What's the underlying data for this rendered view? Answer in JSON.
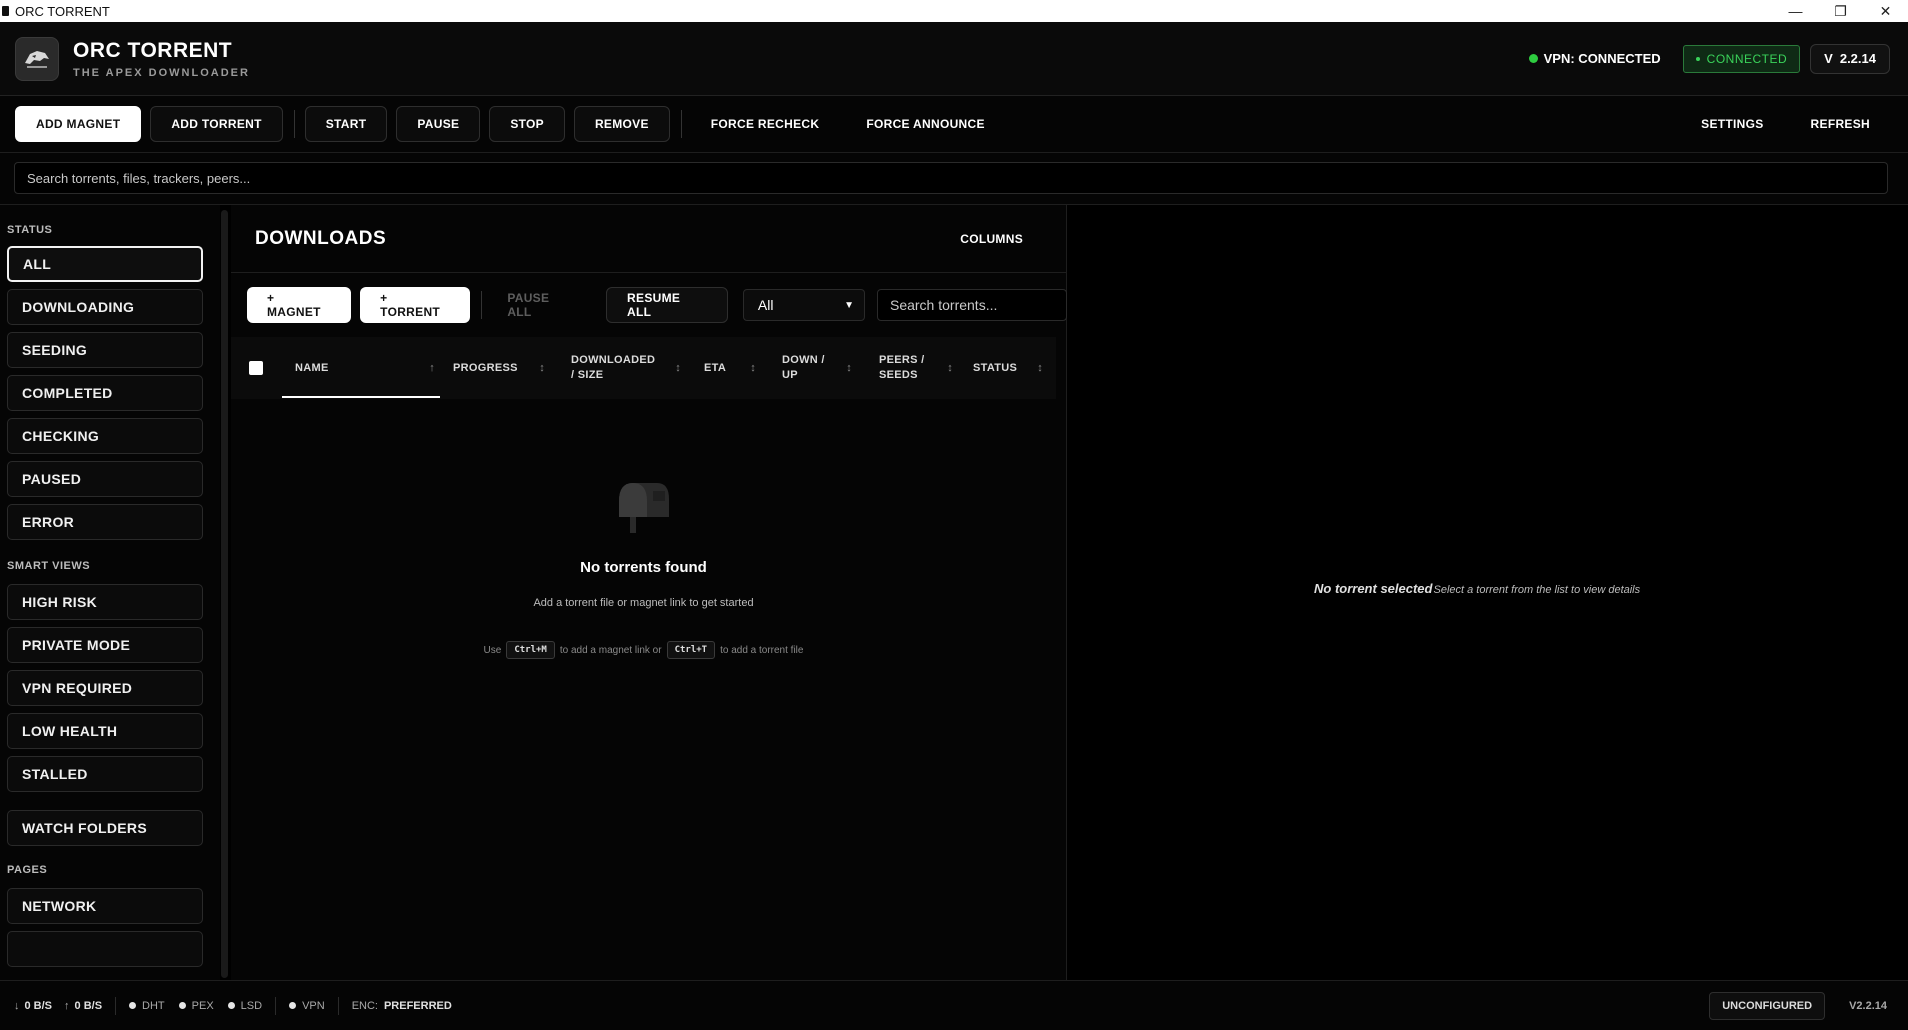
{
  "window": {
    "title": "ORC TORRENT",
    "controls": [
      "—",
      "❐",
      "✕"
    ]
  },
  "header": {
    "brand_title": "ORC TORRENT",
    "brand_subtitle": "THE APEX DOWNLOADER",
    "vpn_status": "VPN: CONNECTED",
    "connection_badge": "CONNECTED",
    "version_prefix": "V",
    "version": "2.2.14",
    "status_color": "#2ecc40"
  },
  "toolbar": {
    "add_magnet": "ADD MAGNET",
    "add_torrent": "ADD TORRENT",
    "start": "START",
    "pause": "PAUSE",
    "stop": "STOP",
    "remove": "REMOVE",
    "force_recheck": "FORCE RECHECK",
    "force_announce": "FORCE ANNOUNCE",
    "settings": "SETTINGS",
    "refresh": "REFRESH"
  },
  "global_search": {
    "placeholder": "Search torrents, files, trackers, peers..."
  },
  "sidebar": {
    "status_heading": "STATUS",
    "status_items": [
      "ALL",
      "DOWNLOADING",
      "SEEDING",
      "COMPLETED",
      "CHECKING",
      "PAUSED",
      "ERROR"
    ],
    "smart_heading": "SMART VIEWS",
    "smart_items": [
      "HIGH RISK",
      "PRIVATE MODE",
      "VPN REQUIRED",
      "LOW HEALTH",
      "STALLED"
    ],
    "watch_folders": "WATCH FOLDERS",
    "pages_heading": "PAGES",
    "pages_items": [
      "NETWORK"
    ]
  },
  "downloads": {
    "title": "DOWNLOADS",
    "columns_button": "COLUMNS",
    "actions": {
      "magnet": "+ MAGNET",
      "torrent": "+ TORRENT",
      "pause_all": "PAUSE ALL",
      "resume_all": "RESUME ALL"
    },
    "filter_value": "All",
    "search_placeholder": "Search torrents...",
    "columns": {
      "name": "NAME",
      "progress": "PROGRESS",
      "downloaded_1": "DOWNLOADED",
      "downloaded_2": "/ SIZE",
      "eta": "ETA",
      "downup_1": "DOWN /",
      "downup_2": "UP",
      "peers_1": "PEERS /",
      "peers_2": "SEEDS",
      "status": "STATUS"
    },
    "sort_icons": {
      "asc": "↑",
      "both": "↕"
    },
    "empty": {
      "title": "No torrents found",
      "subtitle": "Add a torrent file or magnet link to get started",
      "hint_use": "Use",
      "hint_key_magnet": "Ctrl+M",
      "hint_mid": "to add a magnet link or",
      "hint_key_torrent": "Ctrl+T",
      "hint_end": "to add a torrent file"
    }
  },
  "details": {
    "title": "No torrent selected",
    "subtitle": "Select a torrent from the list to view details"
  },
  "statusbar": {
    "down_arrow": "↓",
    "down_speed": "0 B/S",
    "up_arrow": "↑",
    "up_speed": "0 B/S",
    "dht": "DHT",
    "pex": "PEX",
    "lsd": "LSD",
    "vpn": "VPN",
    "enc_label": "ENC:",
    "enc_value": "PREFERRED",
    "config_badge": "UNCONFIGURED",
    "version": "V2.2.14"
  }
}
